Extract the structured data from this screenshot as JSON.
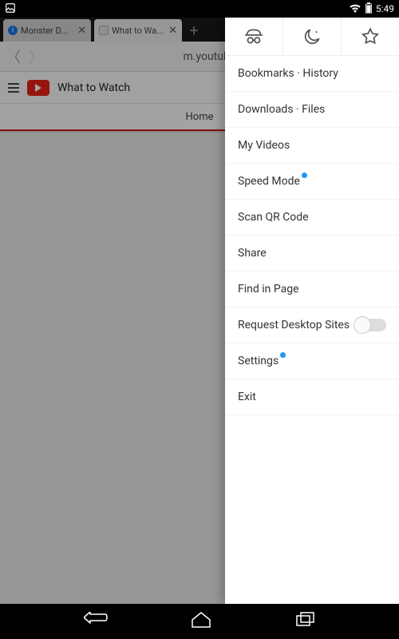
{
  "statusbar": {
    "time": "5:49"
  },
  "tabs": [
    {
      "title": "Monster D..."
    },
    {
      "title": "What to Wa..."
    }
  ],
  "addressbar": {
    "url": "m.youtube.com"
  },
  "page": {
    "title": "What to Watch",
    "home_tab": "Home"
  },
  "panel": {
    "items": {
      "bookmarks": "Bookmarks · History",
      "downloads": "Downloads · Files",
      "myvideos": "My Videos",
      "speedmode": "Speed Mode",
      "scanqr": "Scan QR Code",
      "share": "Share",
      "findinpage": "Find in Page",
      "desktop": "Request Desktop Sites",
      "settings": "Settings",
      "exit": "Exit"
    }
  }
}
